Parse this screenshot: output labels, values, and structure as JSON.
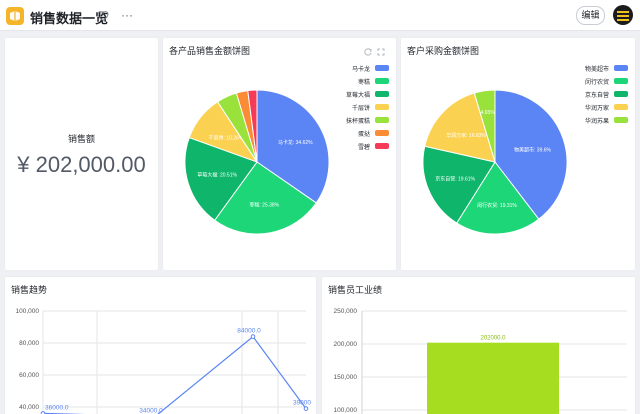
{
  "app": {
    "title": "销售数据一览",
    "edit_label": "编辑",
    "more_label": "···"
  },
  "kpi": {
    "label": "销售额",
    "value": "¥ 202,000.00"
  },
  "colors": {
    "blue": "#5b85f4",
    "green": "#1dd678",
    "darkgreen": "#0fb56a",
    "yellow": "#fbd151",
    "lime": "#99e23c",
    "orange": "#fb8c35",
    "red": "#f53b57",
    "bar": "#a6dd20"
  },
  "chart_data": [
    {
      "type": "pie",
      "title": "各产品销售金额饼图",
      "slices": [
        {
          "name": "马卡龙",
          "value": 34.62,
          "label": "马卡龙: 34.62%",
          "color": "#5b85f4"
        },
        {
          "name": "枣糕",
          "value": 25.38,
          "label": "枣糕: 25.38%",
          "color": "#1dd678"
        },
        {
          "name": "草莓大福",
          "value": 20.51,
          "label": "草莓大福: 20.51%",
          "color": "#0fb56a"
        },
        {
          "name": "千层饼",
          "value": 10.26,
          "label": "千层饼: 10.26%",
          "color": "#fbd151"
        },
        {
          "name": "抹杯蛋糕",
          "value": 4.62,
          "label": "",
          "color": "#99e23c"
        },
        {
          "name": "蛋挞",
          "value": 2.56,
          "label": "",
          "color": "#fb8c35"
        },
        {
          "name": "雪碧",
          "value": 2.05,
          "label": "",
          "color": "#f53b57"
        }
      ],
      "legend_position": "top-right"
    },
    {
      "type": "pie",
      "title": "客户采购金额饼图",
      "slices": [
        {
          "name": "物美超市",
          "value": 39.6,
          "label": "物美超市: 39.6%",
          "color": "#5b85f4"
        },
        {
          "name": "闵行农贸",
          "value": 19.31,
          "label": "闵行农贸: 19.31%",
          "color": "#1dd678"
        },
        {
          "name": "京东自营",
          "value": 19.61,
          "label": "京东自营: 19.61%",
          "color": "#0fb56a"
        },
        {
          "name": "华润万家",
          "value": 16.83,
          "label": "华润万家: 16.83%",
          "color": "#fbd151"
        },
        {
          "name": "华润苏果",
          "value": 4.65,
          "label": "4.65%",
          "color": "#99e23c"
        }
      ],
      "legend_position": "top-right"
    },
    {
      "type": "line",
      "title": "销售趋势",
      "ylim": [
        0,
        100000
      ],
      "yticks": [
        "100,000",
        "80,000",
        "60,000",
        "40,000"
      ],
      "points": [
        {
          "x": 0,
          "y": 36000,
          "label": "36000.0"
        },
        {
          "x": 1,
          "y": 34000,
          "label": "34000.0"
        },
        {
          "x": 2,
          "y": 84000,
          "label": "84000.0"
        },
        {
          "x": 3,
          "y": 39000,
          "label": "39000"
        }
      ],
      "color": "#5b85f4"
    },
    {
      "type": "bar",
      "title": "销售员工业绩",
      "ylim": [
        0,
        250000
      ],
      "yticks": [
        "250,000",
        "200,000",
        "150,000",
        "100,000"
      ],
      "values": [
        202000
      ],
      "labels": [
        "202000.0"
      ],
      "color": "#a6dd20"
    }
  ]
}
